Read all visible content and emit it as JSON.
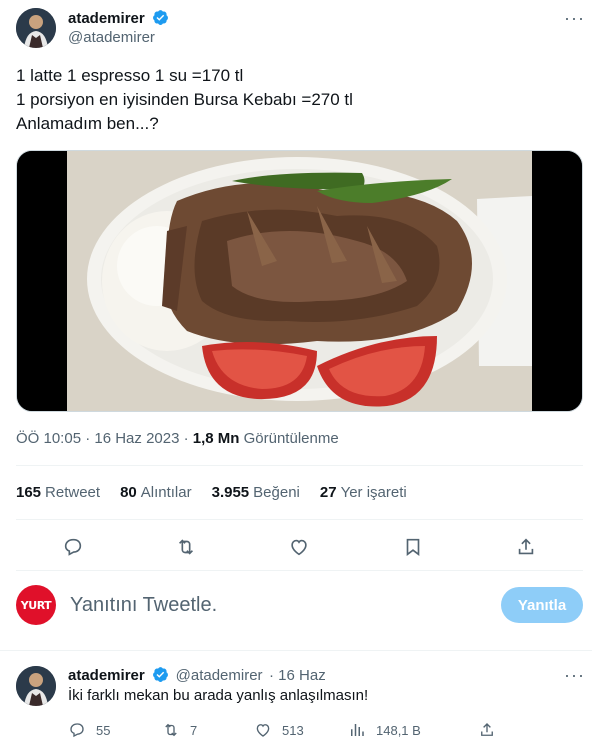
{
  "tweet": {
    "display_name": "atademirer",
    "handle": "@atademirer",
    "text_lines": [
      "1 latte 1 espresso 1 su =170 tl",
      "1 porsiyon en iyisinden Bursa Kebabı =270 tl",
      "Anlamadım ben...?"
    ],
    "time": "ÖÖ 10:05 · 16 Haz 2023 · ",
    "views_count": "1,8 Mn",
    "views_label": " Görüntülenme",
    "stats": {
      "retweets": {
        "count": "165",
        "label": "Retweet"
      },
      "quotes": {
        "count": "80",
        "label": "Alıntılar"
      },
      "likes": {
        "count": "3.955",
        "label": "Beğeni"
      },
      "bookmarks": {
        "count": "27",
        "label": "Yer işareti"
      }
    }
  },
  "reply_composer": {
    "avatar_text": "YURT",
    "placeholder": "Yanıtını Tweetle.",
    "button_label": "Yanıtla"
  },
  "reply": {
    "display_name": "atademirer",
    "handle": "@atademirer",
    "date": "· 16 Haz",
    "text": "İki farklı mekan bu arada yanlış anlaşılmasın!",
    "counts": {
      "replies": "55",
      "retweets": "7",
      "likes": "513",
      "views": "148,1 B"
    }
  },
  "icons": {
    "verified_color": "#1d9bf0",
    "action_color": "#536471",
    "reply_button_color": "#8ecdf8"
  }
}
